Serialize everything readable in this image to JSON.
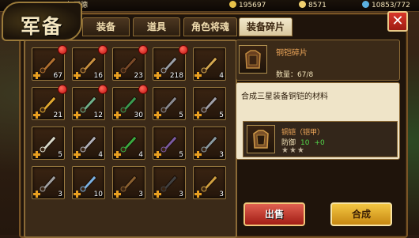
{
  "topbar": {
    "player_name": "何正德",
    "coins": "195697",
    "gold": "8571",
    "stamina": "10853/772"
  },
  "title": "军备",
  "tabs": [
    {
      "label": "装备",
      "active": false
    },
    {
      "label": "道具",
      "active": false
    },
    {
      "label": "角色将魂",
      "active": false
    },
    {
      "label": "装备碎片",
      "active": true
    }
  ],
  "close_label": "✕",
  "grid_items": [
    {
      "icon": "armor-fragment-icon",
      "count": "67",
      "red_dot": true
    },
    {
      "icon": "bow-fragment-icon",
      "count": "16",
      "red_dot": true
    },
    {
      "icon": "leather-armor-fragment-icon",
      "count": "23",
      "red_dot": true
    },
    {
      "icon": "dagger-fragment-icon",
      "count": "218",
      "red_dot": true
    },
    {
      "icon": "longbow-fragment-icon",
      "count": "4",
      "red_dot": false
    },
    {
      "icon": "golden-spear-fragment-icon",
      "count": "21",
      "red_dot": true
    },
    {
      "icon": "jade-blade-fragment-icon",
      "count": "12",
      "red_dot": true
    },
    {
      "icon": "green-sword-fragment-icon",
      "count": "30",
      "red_dot": true
    },
    {
      "icon": "black-blade-fragment-icon",
      "count": "5",
      "red_dot": false
    },
    {
      "icon": "battle-axe-fragment-icon",
      "count": "5",
      "red_dot": false
    },
    {
      "icon": "fan-fragment-icon",
      "count": "5",
      "red_dot": false
    },
    {
      "icon": "steel-dagger-fragment-icon",
      "count": "4",
      "red_dot": false
    },
    {
      "icon": "green-spear-fragment-icon",
      "count": "4",
      "red_dot": false
    },
    {
      "icon": "scimitar-fragment-icon",
      "count": "5",
      "red_dot": false
    },
    {
      "icon": "war-armor-fragment-icon",
      "count": "3",
      "red_dot": false
    },
    {
      "icon": "helmet-fragment-icon",
      "count": "3",
      "red_dot": false
    },
    {
      "icon": "blue-robe-fragment-icon",
      "count": "10",
      "red_dot": false
    },
    {
      "icon": "staff-fragment-icon",
      "count": "3",
      "red_dot": false
    },
    {
      "icon": "dark-helmet-fragment-icon",
      "count": "3",
      "red_dot": false
    },
    {
      "icon": "gauntlet-fragment-icon",
      "count": "3",
      "red_dot": false
    }
  ],
  "detail": {
    "name": "铜铠碎片",
    "quantity": "数量：67/8",
    "description": "合成三星装备铜铠的材料",
    "target_name": "铜铠（铠甲）",
    "target_stat_label": "防御",
    "target_stat_value": "10",
    "target_stat_bonus": "+0",
    "stars": "★★★",
    "sell_label": "出售",
    "merge_label": "合成"
  },
  "colors": {
    "accent_orange": "#f0a85a",
    "stat_green": "#52d64a",
    "red_dot": "#d01818"
  }
}
